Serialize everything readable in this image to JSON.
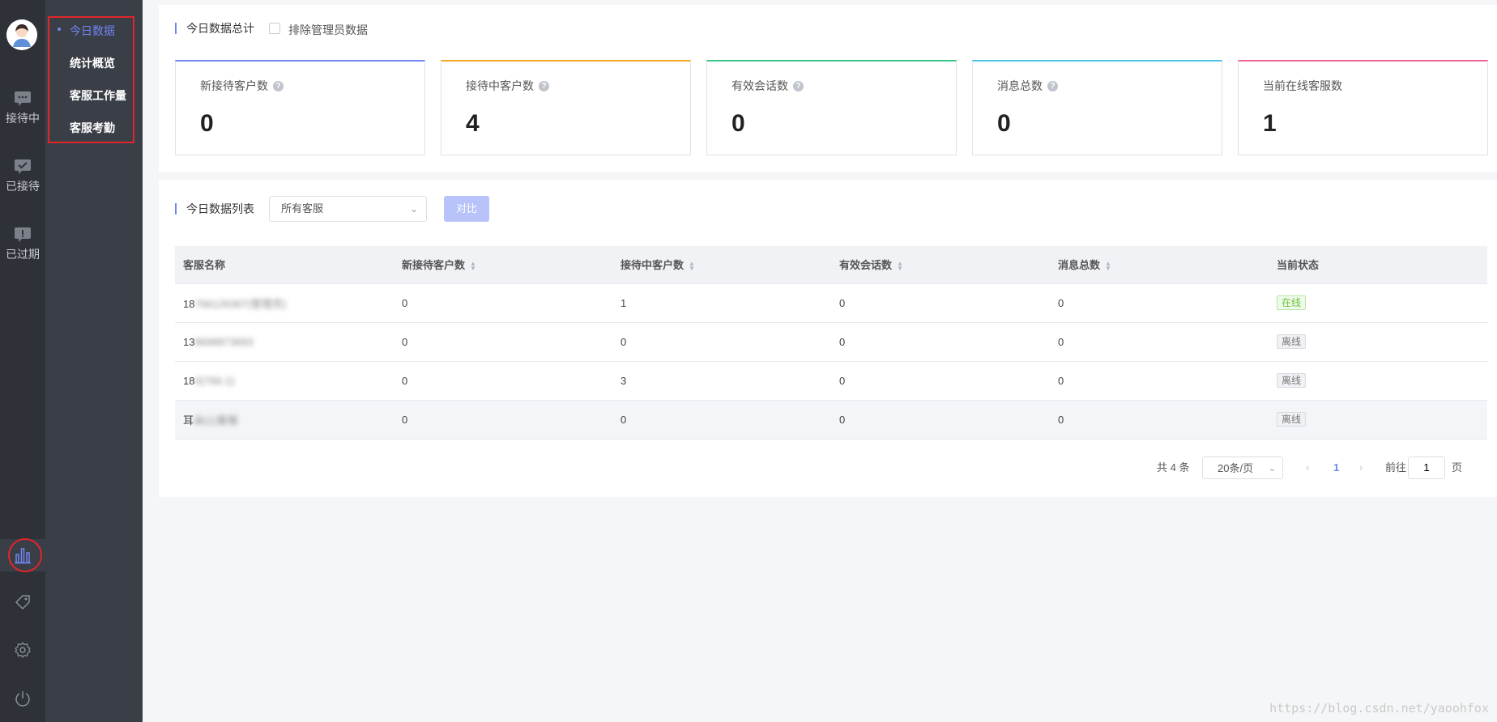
{
  "rail": {
    "items": [
      {
        "label": "接待中",
        "icon": "chat-icon"
      },
      {
        "label": "已接待",
        "icon": "check-message-icon"
      },
      {
        "label": "已过期",
        "icon": "alert-message-icon"
      }
    ],
    "bottom_icons": [
      "bar-chart-icon",
      "tag-icon",
      "gear-icon",
      "power-icon"
    ]
  },
  "submenu": {
    "items": [
      {
        "label": "今日数据",
        "active": true
      },
      {
        "label": "统计概览"
      },
      {
        "label": "客服工作量"
      },
      {
        "label": "客服考勤"
      }
    ]
  },
  "summary": {
    "title": "今日数据总计",
    "exclude_admin_label": "排除管理员数据",
    "cards": [
      {
        "label": "新接待客户数",
        "value": "0",
        "color": "#6f86f5",
        "help": true
      },
      {
        "label": "接待中客户数",
        "value": "4",
        "color": "#f5a623",
        "help": true
      },
      {
        "label": "有效会话数",
        "value": "0",
        "color": "#3cc68a",
        "help": true
      },
      {
        "label": "消息总数",
        "value": "0",
        "color": "#4fc3e8",
        "help": true
      },
      {
        "label": "当前在线客服数",
        "value": "1",
        "color": "#f0649a",
        "help": false
      }
    ]
  },
  "list": {
    "title": "今日数据列表",
    "select_value": "所有客服",
    "compare_label": "对比",
    "columns": [
      "客服名称",
      "新接待客户数",
      "接待中客户数",
      "有效会话数",
      "消息总数",
      "当前状态"
    ],
    "rows": [
      {
        "name_prefix": "18",
        "name_hidden": "766126367(管理员)",
        "c1": "0",
        "c2": "1",
        "c3": "0",
        "c4": "0",
        "status": "在线"
      },
      {
        "name_prefix": "13",
        "name_hidden": "8698873693",
        "c1": "0",
        "c2": "0",
        "c3": "0",
        "c4": "0",
        "status": "离线"
      },
      {
        "name_prefix": "18",
        "name_hidden": "0(766-1)",
        "c1": "0",
        "c2": "3",
        "c3": "0",
        "c4": "0",
        "status": "离线"
      },
      {
        "name_prefix": "耳",
        "name_hidden": "朵(1)客服",
        "c1": "0",
        "c2": "0",
        "c3": "0",
        "c4": "0",
        "status": "离线"
      }
    ],
    "pagination": {
      "total": "共 4 条",
      "page_size": "20条/页",
      "current_page": "1",
      "goto_label": "前往",
      "goto_value": "1",
      "page_unit": "页"
    }
  },
  "watermark": "https://blog.csdn.net/yaoohfox"
}
